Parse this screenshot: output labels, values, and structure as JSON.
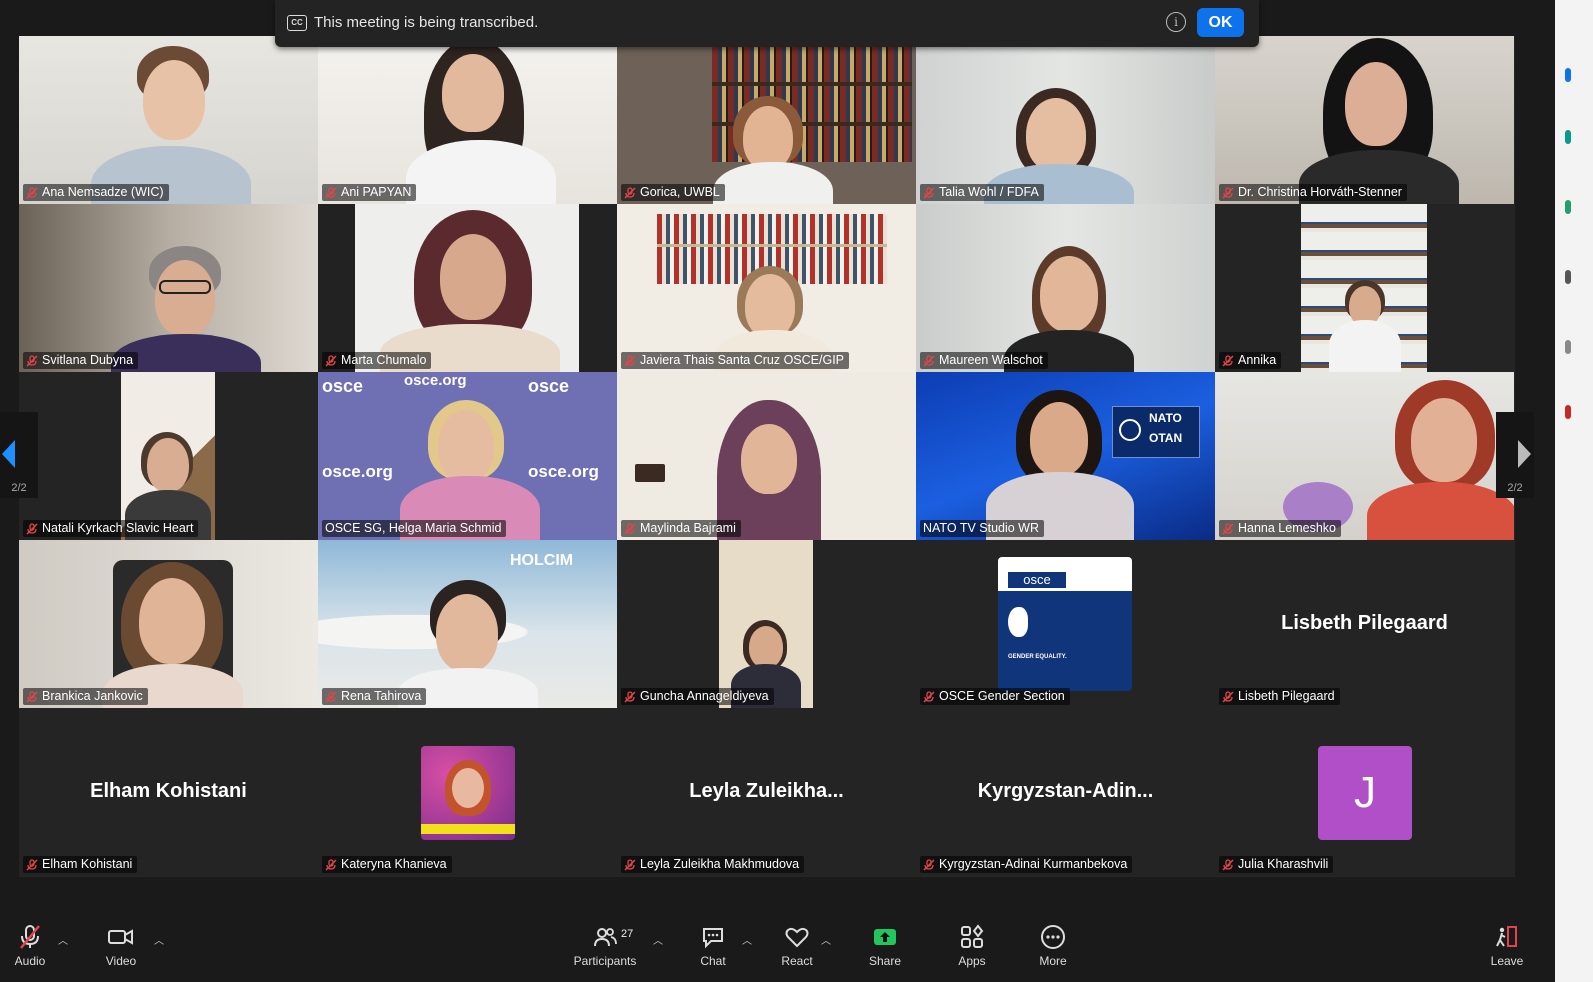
{
  "banner": {
    "text": "This meeting is being transcribed.",
    "ok_label": "OK",
    "cc_label": "CC",
    "info_label": "i"
  },
  "pager": {
    "left_label": "2/2",
    "right_label": "2/2"
  },
  "participants": [
    {
      "name": "Ana Nemsadze (WIC)",
      "muted": true
    },
    {
      "name": "Ani PAPYAN",
      "muted": true
    },
    {
      "name": "Gorica, UWBL",
      "muted": true
    },
    {
      "name": "Talia Wohl / FDFA",
      "muted": true
    },
    {
      "name": "Dr. Christina Horváth-Stenner",
      "muted": true
    },
    {
      "name": "Svitlana Dubyna",
      "muted": true
    },
    {
      "name": "Marta Chumalo",
      "muted": true
    },
    {
      "name": "Javiera Thais Santa Cruz OSCE/GIP",
      "muted": true
    },
    {
      "name": "Maureen Walschot",
      "muted": true
    },
    {
      "name": "Annika",
      "muted": true
    },
    {
      "name": "Natali Kyrkach Slavic Heart",
      "muted": true
    },
    {
      "name": "OSCE SG, Helga Maria Schmid",
      "muted": false,
      "speaking": true
    },
    {
      "name": "Maylinda Bajrami",
      "muted": true
    },
    {
      "name": "NATO TV Studio WR",
      "muted": false
    },
    {
      "name": "Hanna Lemeshko",
      "muted": true
    },
    {
      "name": "Brankica Jankovic",
      "muted": true
    },
    {
      "name": "Rena Tahirova",
      "muted": true
    },
    {
      "name": "Guncha Annageldiyeva",
      "muted": true
    },
    {
      "name": "OSCE Gender Section",
      "muted": true
    },
    {
      "name": "Lisbeth Pilegaard",
      "muted": true,
      "display": "Lisbeth Pilegaard"
    },
    {
      "name": "Elham Kohistani",
      "muted": true,
      "display": "Elham Kohistani"
    },
    {
      "name": "Kateryna Khanieva",
      "muted": true
    },
    {
      "name": "Leyla Zuleikha Makhmudova",
      "muted": true,
      "display": "Leyla  Zuleikha..."
    },
    {
      "name": "Kyrgyzstan-Adinai Kurmanbekova",
      "muted": true,
      "display": "Kyrgyzstan-Adin..."
    },
    {
      "name": "Julia Kharashvili",
      "muted": true,
      "avatar_letter": "J"
    }
  ],
  "overlays": {
    "osce_tags": "osce",
    "osce_org": "osce.org",
    "holcim": "HOLCIM",
    "nato": "NATO",
    "otan": "OTAN",
    "gender_card_logo": "osce",
    "gender_card_text": "GENDER EQUALITY."
  },
  "toolbar": {
    "audio": "Audio",
    "video": "Video",
    "participants": "Participants",
    "participants_count": "27",
    "chat": "Chat",
    "react": "React",
    "share": "Share",
    "apps": "Apps",
    "more": "More",
    "leave": "Leave"
  },
  "colors": {
    "speaking_border": "#2bd18c",
    "ok_button": "#0e72ed",
    "share_icon": "#22c55e",
    "muted_icon": "#e0454b",
    "avatar_bg": "#b04fc8"
  }
}
